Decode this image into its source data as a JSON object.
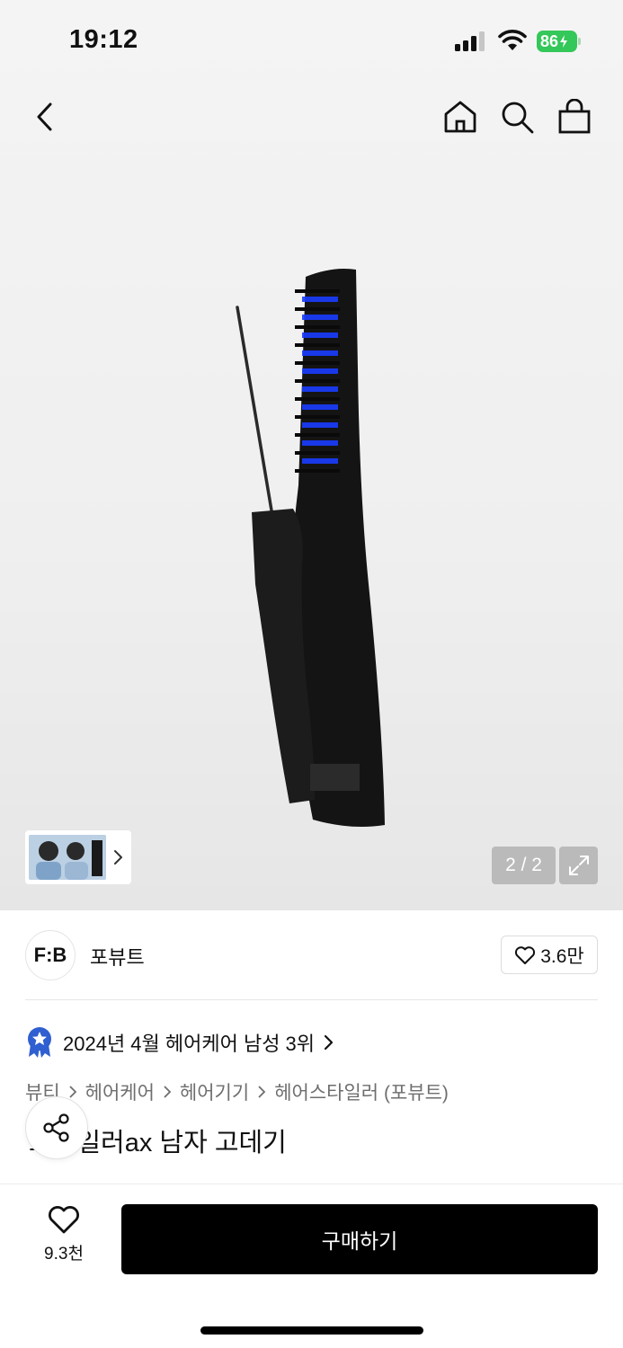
{
  "status_bar": {
    "time": "19:12",
    "battery": "86",
    "icons": [
      "signal-icon",
      "wifi-icon",
      "battery-icon"
    ]
  },
  "nav": {
    "icons": [
      "back-icon",
      "home-icon",
      "search-icon",
      "bag-icon"
    ]
  },
  "gallery": {
    "counter": "2 / 2",
    "icons": [
      "expand-icon",
      "chevron-right-icon"
    ]
  },
  "brand": {
    "logo": "F:B",
    "name": "포뷰트",
    "likes": "3.6만"
  },
  "ranking": {
    "text": "2024년 4월 헤어케어 남성 3위"
  },
  "breadcrumb": [
    "뷰티",
    "헤어케어",
    "헤어기기",
    "헤어스타일러 (포뷰트)"
  ],
  "product": {
    "title": "스타일러ax 남자 고데기"
  },
  "bottom_bar": {
    "wish_count": "9.3천",
    "buy_label": "구매하기"
  },
  "colors": {
    "accent": "#000000",
    "battery": "#34c759",
    "rank_badge": "#2f5fd0"
  }
}
